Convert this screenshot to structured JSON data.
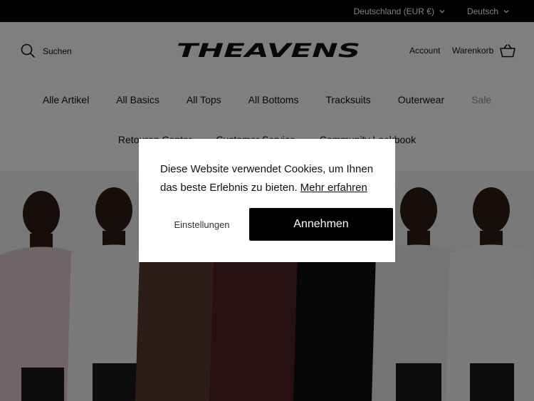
{
  "topbar": {
    "country": "Deutschland (EUR €)",
    "language": "Deutsch"
  },
  "header": {
    "search_label": "Suchen",
    "logo_text": "THEAVENS",
    "account_label": "Account",
    "cart_label": "Warenkorb"
  },
  "nav": {
    "row1": [
      "Alle Artikel",
      "All Basics",
      "All Tops",
      "All Bottoms",
      "Tracksuits",
      "Outerwear",
      "Sale"
    ],
    "row2": [
      "Retouren Center",
      "Customer Service",
      "Community Lookbook"
    ]
  },
  "cookie": {
    "message": "Diese Website verwendet Cookies, um Ihnen das beste Erlebnis zu bieten.",
    "more_link": "Mehr erfahren",
    "settings_button": "Einstellungen",
    "accept_button": "Annehmen"
  },
  "colors": {
    "topbar_bg": "#000000",
    "accept_bg": "#000000",
    "sale_text": "#9a9a9a",
    "overlay": "rgba(0,0,0,0.5)"
  }
}
